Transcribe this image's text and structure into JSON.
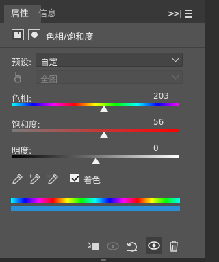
{
  "tabs": [
    {
      "label": "属性"
    },
    {
      "label": "信息"
    }
  ],
  "tab_bar": {
    "collapse_label": ">>"
  },
  "header": {
    "title": "色相/饱和度"
  },
  "preset": {
    "label": "预设:",
    "value": "自定"
  },
  "channel": {
    "value": "全图"
  },
  "hue": {
    "label": "色相:",
    "value": "203",
    "position": 0.55
  },
  "saturation": {
    "label": "饱和度:",
    "value": "56",
    "position": 0.55
  },
  "lightness": {
    "label": "明度:",
    "value": "0",
    "position": 0.5
  },
  "colorize": {
    "label": "着色",
    "checked": true
  },
  "colors": {
    "panel": "#535353",
    "tabbar": "#383838",
    "colorize_bar": "#2a8fd6"
  }
}
